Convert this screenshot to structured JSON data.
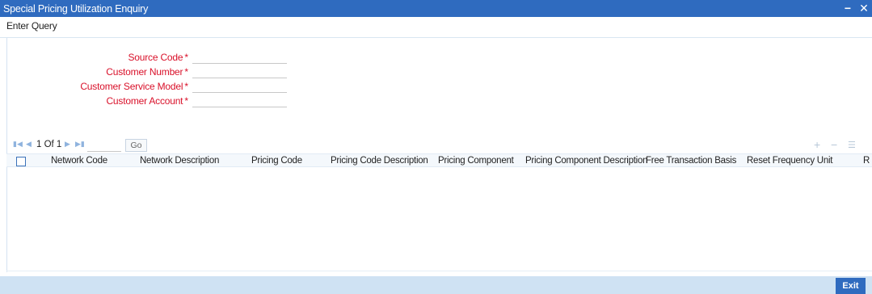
{
  "window": {
    "title": "Special Pricing Utilization Enquiry",
    "minimize_glyph": "−",
    "close_glyph": "✕"
  },
  "menu": {
    "enter_query": "Enter Query"
  },
  "form": {
    "required_marker": "*",
    "fields": [
      {
        "label": "Source Code",
        "value": ""
      },
      {
        "label": "Customer Number",
        "value": ""
      },
      {
        "label": "Customer Service Model",
        "value": ""
      },
      {
        "label": "Customer Account",
        "value": ""
      }
    ]
  },
  "pager": {
    "page_text": "1 Of 1",
    "go_label": "Go",
    "go_value": "",
    "icons": [
      "first-page-icon",
      "prev-page-icon",
      "next-page-icon",
      "last-page-icon",
      "add-row-icon",
      "delete-row-icon",
      "single-view-icon"
    ]
  },
  "grid": {
    "columns": [
      "Network Code",
      "Network Description",
      "Pricing Code",
      "Pricing Code Description",
      "Pricing Component",
      "Pricing Component Description",
      "Free Transaction Basis",
      "Reset Frequency Unit",
      "R"
    ],
    "rows": []
  },
  "footer": {
    "exit_label": "Exit"
  },
  "colors": {
    "title_bar": "#2f6bbf",
    "required_label": "#d9112a",
    "footer_bar": "#cfe2f3",
    "nav_icon": "#8fb3de"
  }
}
